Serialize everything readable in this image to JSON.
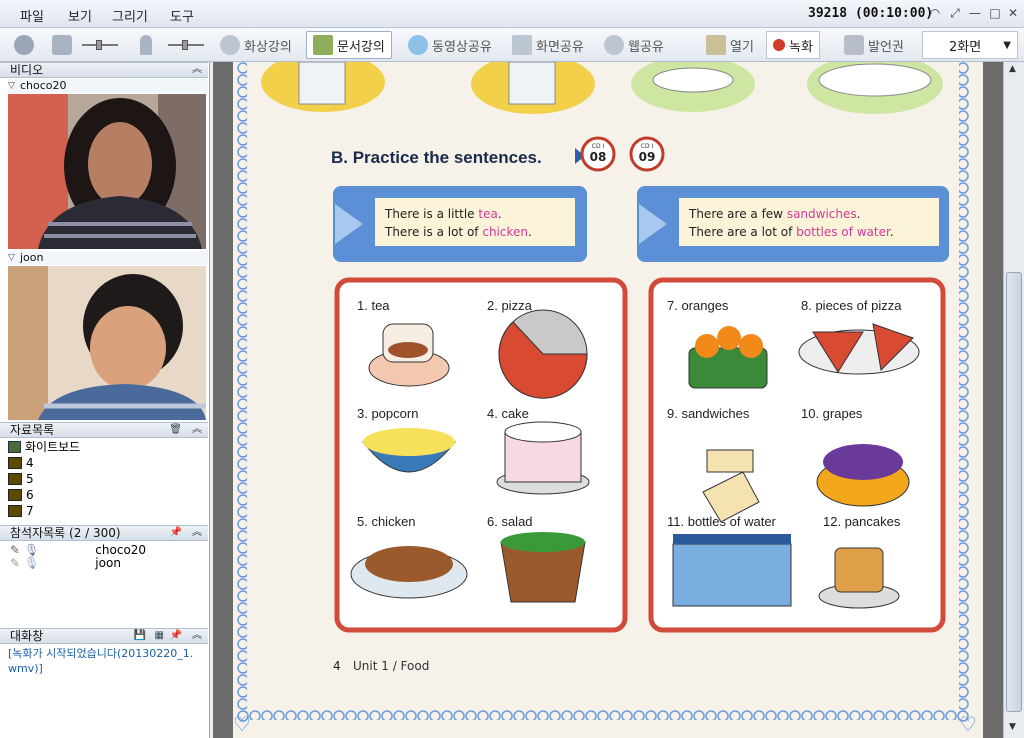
{
  "menu": [
    "파일",
    "보기",
    "그리기",
    "도구"
  ],
  "session": "39218 (00:10:00)",
  "toolbar": {
    "video_lecture": "화상강의",
    "doc_lecture": "문서강의",
    "video_share": "동영상공유",
    "screen_share": "화면공유",
    "web_share": "웹공유",
    "open": "열기",
    "record": "녹화",
    "speak_right": "발언권",
    "screen_mode": "2화면"
  },
  "panels": {
    "video": {
      "title": "비디오",
      "users": [
        "choco20",
        "joon"
      ]
    },
    "resources": {
      "title": "자료목록",
      "items": [
        "화이트보드",
        "4",
        "5",
        "6",
        "7"
      ]
    },
    "attendees": {
      "title": "참석자목록 (2 / 300)",
      "users": [
        "choco20",
        "joon"
      ]
    },
    "chat": {
      "title": "대화창",
      "message": "[녹화가 시작되었습니다(20130220_1.wmv)]"
    }
  },
  "book": {
    "heading": "B. Practice the sentences.",
    "cd_label": "CD I",
    "tracks": [
      "08",
      "09"
    ],
    "box_left": {
      "line1_pre": "There is a little ",
      "line1_hl": "tea",
      "line1_post": ".",
      "line2_pre": "There is a lot of ",
      "line2_hl": "chicken",
      "line2_post": "."
    },
    "box_right": {
      "line1_pre": "There are a few ",
      "line1_hl": "sandwiches",
      "line1_post": ".",
      "line2_pre": "There are a lot of ",
      "line2_hl": "bottles of water",
      "line2_post": "."
    },
    "items_left": [
      "1. tea",
      "2. pizza",
      "3. popcorn",
      "4. cake",
      "5. chicken",
      "6. salad"
    ],
    "items_right": [
      "7. oranges",
      "8. pieces of pizza",
      "9. sandwiches",
      "10. grapes",
      "11. bottles of water",
      "12. pancakes"
    ],
    "footer_page": "4",
    "footer_text": "Unit 1 / Food"
  }
}
